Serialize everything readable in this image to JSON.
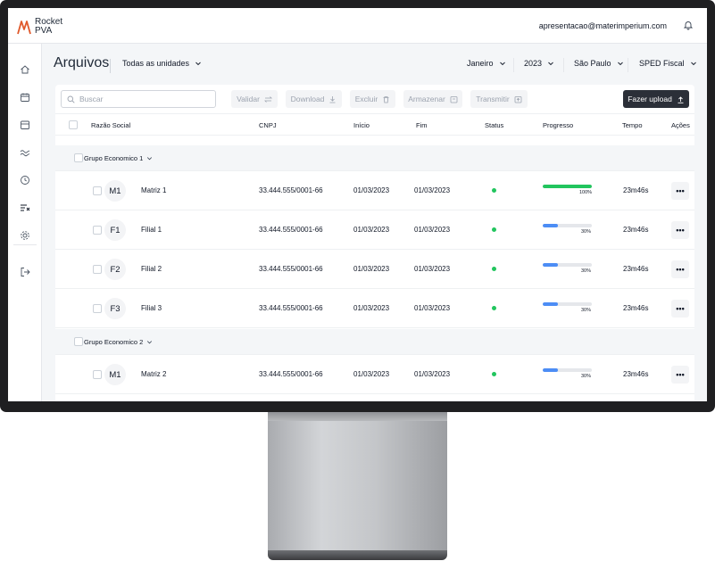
{
  "brand": {
    "line1": "Rocket",
    "line2": "PVA",
    "color": "#e0592b"
  },
  "header": {
    "email": "apresentacao@materimperium.com"
  },
  "sidebar": {
    "icons": [
      "home-icon",
      "calendar-icon",
      "store-icon",
      "chart-wave-icon",
      "clock-icon",
      "filter-list-icon",
      "gear-icon",
      "logout-icon"
    ]
  },
  "page": {
    "title": "Arquivos",
    "unit_filter": "Todas as unidades",
    "month_filter": "Janeiro",
    "year_filter": "2023",
    "city_filter": "São Paulo",
    "type_filter": "SPED Fiscal"
  },
  "toolbar": {
    "search_placeholder": "Buscar",
    "validar": "Validar",
    "download": "Download",
    "excluir": "Excluir",
    "armazenar": "Armazenar",
    "transmitir": "Transmitir",
    "upload": "Fazer upload"
  },
  "table": {
    "headers": {
      "razao": "Razão Social",
      "cnpj": "CNPJ",
      "inicio": "Início",
      "fim": "Fim",
      "status": "Status",
      "progresso": "Progresso",
      "tempo": "Tempo",
      "acoes": "Ações"
    },
    "groups": [
      {
        "name": "Grupo Economico 1",
        "rows": [
          {
            "initials": "M1",
            "name": "Matriz 1",
            "cnpj": "33.444.555/0001-66",
            "inicio": "01/03/2023",
            "fim": "01/03/2023",
            "progress": 1.0,
            "progress_label": "100%",
            "tempo": "23m46s",
            "action": "•••"
          },
          {
            "initials": "F1",
            "name": "Filial 1",
            "cnpj": "33.444.555/0001-66",
            "inicio": "01/03/2023",
            "fim": "01/03/2023",
            "progress": 0.3,
            "progress_label": "30%",
            "tempo": "23m46s",
            "action": "•••"
          },
          {
            "initials": "F2",
            "name": "Filial 2",
            "cnpj": "33.444.555/0001-66",
            "inicio": "01/03/2023",
            "fim": "01/03/2023",
            "progress": 0.3,
            "progress_label": "30%",
            "tempo": "23m46s",
            "action": "•••"
          },
          {
            "initials": "F3",
            "name": "Filial 3",
            "cnpj": "33.444.555/0001-66",
            "inicio": "01/03/2023",
            "fim": "01/03/2023",
            "progress": 0.3,
            "progress_label": "30%",
            "tempo": "23m46s",
            "action": "•••"
          }
        ]
      },
      {
        "name": "Grupo Economico 2",
        "rows": [
          {
            "initials": "M1",
            "name": "Matriz 2",
            "cnpj": "33.444.555/0001-66",
            "inicio": "01/03/2023",
            "fim": "01/03/2023",
            "progress": 0.3,
            "progress_label": "30%",
            "tempo": "23m46s",
            "action": "•••"
          }
        ]
      }
    ]
  },
  "colors": {
    "status_ok": "#22c55e",
    "progress_complete": "#22c55e",
    "progress_partial": "#4c8df5",
    "upload_button": "#2b2f38"
  }
}
